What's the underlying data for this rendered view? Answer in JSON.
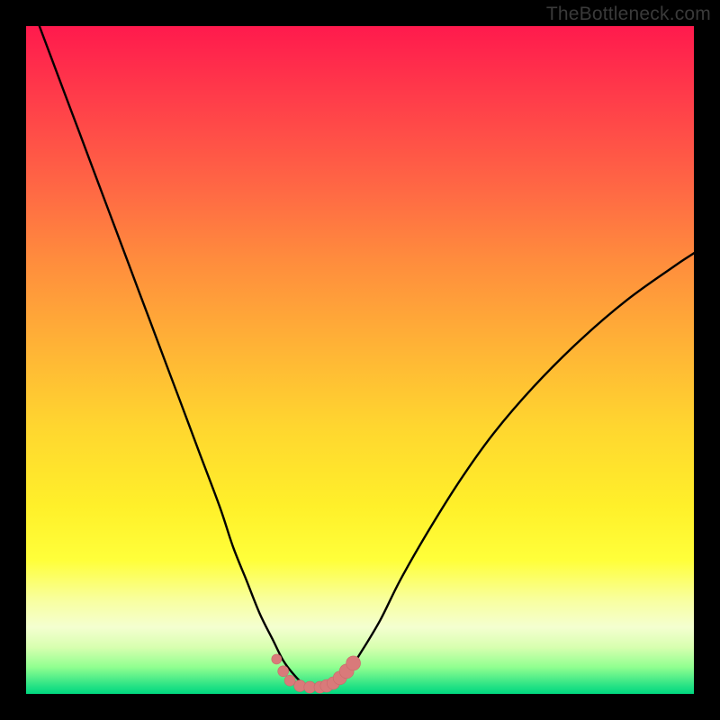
{
  "watermark": "TheBottleneck.com",
  "colors": {
    "page_bg": "#000000",
    "curve_stroke": "#000000",
    "marker_fill": "#d97a7a",
    "marker_stroke": "#c96a6a"
  },
  "chart_data": {
    "type": "line",
    "title": "",
    "xlabel": "",
    "ylabel": "",
    "xlim": [
      0,
      100
    ],
    "ylim": [
      0,
      100
    ],
    "grid": false,
    "legend": false,
    "series": [
      {
        "name": "bottleneck-curve",
        "x": [
          2,
          5,
          8,
          11,
          14,
          17,
          20,
          23,
          26,
          29,
          31,
          33,
          35,
          37,
          38.5,
          40,
          41.5,
          43,
          44.5,
          46,
          48,
          50,
          53,
          56,
          60,
          65,
          70,
          76,
          83,
          90,
          97,
          100
        ],
        "y": [
          100,
          92,
          84,
          76,
          68,
          60,
          52,
          44,
          36,
          28,
          22,
          17,
          12,
          8,
          5,
          3,
          1.5,
          1,
          1,
          1.5,
          3,
          6,
          11,
          17,
          24,
          32,
          39,
          46,
          53,
          59,
          64,
          66
        ]
      }
    ],
    "markers": {
      "name": "valley-dots",
      "x": [
        37.5,
        38.5,
        39.5,
        41,
        42.5,
        44,
        45,
        46,
        47,
        48,
        49
      ],
      "y": [
        5.2,
        3.4,
        2.0,
        1.2,
        1.0,
        1.0,
        1.2,
        1.6,
        2.4,
        3.4,
        4.6
      ],
      "r": [
        5.5,
        6,
        6,
        6.5,
        6.5,
        6.5,
        7,
        7,
        7.5,
        8,
        8
      ]
    }
  }
}
